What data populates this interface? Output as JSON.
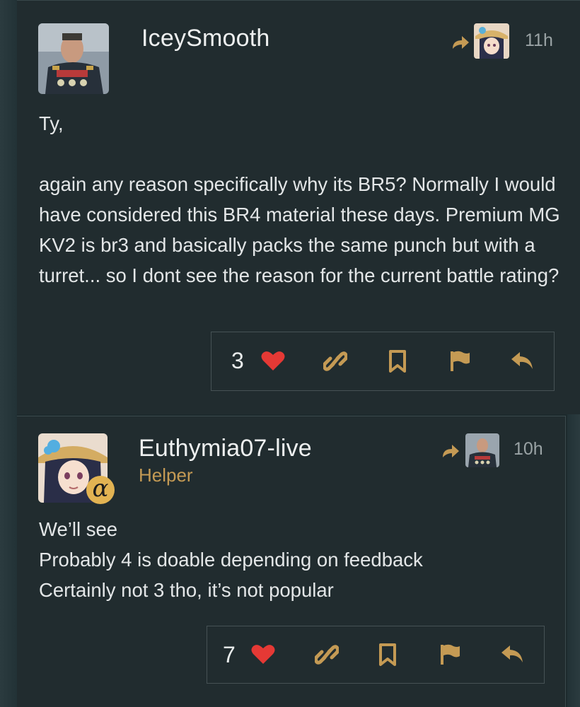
{
  "posts": [
    {
      "username": "IceySmooth",
      "group": "",
      "time": "11h",
      "avatar": "general-portrait-avatar",
      "reply_to_avatar": "anime-girl-avatar",
      "body": [
        "Ty,",
        "",
        "again any reason specifically why its BR5? Normally I would have considered this BR4 material these days. Premium MG KV2 is br3 and basically packs the same punch but with a turret... so I dont see the reason for the current battle rating?"
      ],
      "likes": "3"
    },
    {
      "username": "Euthymia07-live",
      "group": "Helper",
      "time": "10h",
      "avatar": "anime-girl-avatar",
      "badge": "α",
      "reply_to_avatar": "general-portrait-avatar",
      "body": [
        "We’ll see",
        "Probably 4 is doable depending on feedback",
        "Certainly not 3 tho, it’s not popular"
      ],
      "likes": "7"
    }
  ],
  "colors": {
    "background": "#212c2f",
    "accent": "#c49a54",
    "heart": "#e53935",
    "icon": "#c49a54",
    "text": "#e3e6e7"
  },
  "icons": [
    "heart-icon",
    "link-icon",
    "bookmark-icon",
    "flag-icon",
    "reply-icon",
    "reply-to-arrow-icon"
  ]
}
